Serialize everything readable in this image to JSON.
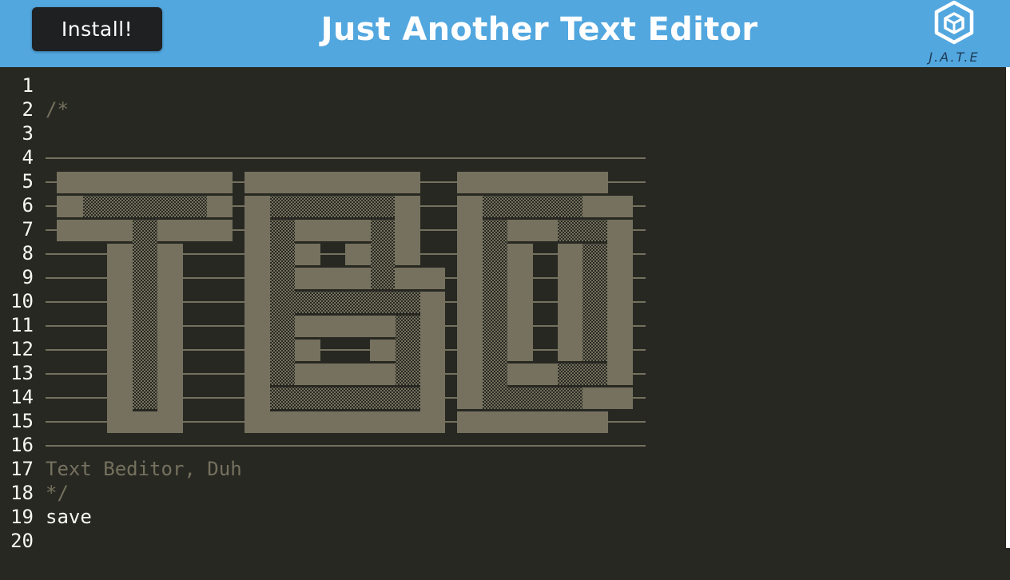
{
  "header": {
    "install_label": "Install!",
    "title": "Just Another Text Editor",
    "logo_text": "J.A.T.E"
  },
  "editor": {
    "lines": [
      {
        "n": "1",
        "text": ""
      },
      {
        "n": "2",
        "text": "/*"
      },
      {
        "n": "3",
        "text": ""
      },
      {
        "n": "4",
        "text": ""
      },
      {
        "n": "5",
        "text": ""
      },
      {
        "n": "6",
        "text": ""
      },
      {
        "n": "7",
        "text": ""
      },
      {
        "n": "8",
        "text": ""
      },
      {
        "n": "9",
        "text": ""
      },
      {
        "n": "10",
        "text": ""
      },
      {
        "n": "11",
        "text": ""
      },
      {
        "n": "12",
        "text": ""
      },
      {
        "n": "13",
        "text": ""
      },
      {
        "n": "14",
        "text": ""
      },
      {
        "n": "15",
        "text": ""
      },
      {
        "n": "16",
        "text": ""
      },
      {
        "n": "17",
        "text": "Text Beditor, Duh"
      },
      {
        "n": "18",
        "text": "*/"
      },
      {
        "n": "19",
        "text": "save"
      },
      {
        "n": "20",
        "text": ""
      }
    ],
    "ascii_art_text": "TBD"
  },
  "colors": {
    "header_bg": "#52a7df",
    "editor_bg": "#272822",
    "comment": "#75715e",
    "text": "#f8f8f2"
  }
}
